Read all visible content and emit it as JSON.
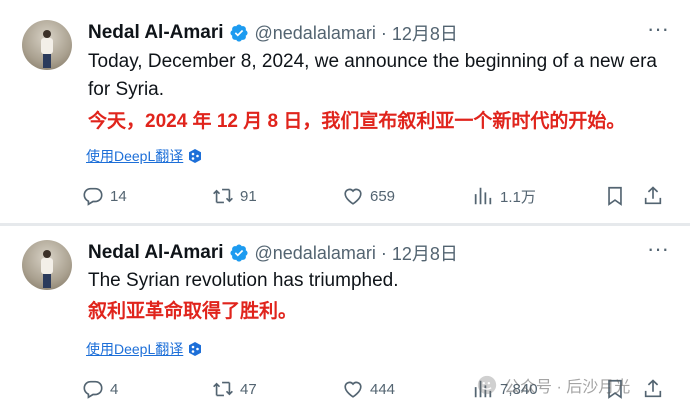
{
  "tweets": [
    {
      "author_name": "Nedal Al-Amari",
      "handle": "@nedalalamari",
      "separator": "·",
      "date": "12月8日",
      "text_en": "Today, December 8, 2024, we announce the beginning of a new era for Syria.",
      "text_zh": "今天，2024 年 12 月 8 日，我们宣布叙利亚一个新时代的开始。",
      "translate_label": "使用DeepL翻译",
      "replies": "14",
      "retweets": "91",
      "likes": "659",
      "views": "1.1万"
    },
    {
      "author_name": "Nedal Al-Amari",
      "handle": "@nedalalamari",
      "separator": "·",
      "date": "12月8日",
      "text_en": "The Syrian revolution has triumphed.",
      "text_zh": "叙利亚革命取得了胜利。",
      "translate_label": "使用DeepL翻译",
      "replies": "4",
      "retweets": "47",
      "likes": "444",
      "views": "7,840"
    }
  ],
  "watermark": "公众号 · 后沙月光",
  "colors": {
    "verified": "#1d9bf0",
    "chinese_text": "#e0241c",
    "link": "#1d6fd8",
    "secondary": "#536471"
  }
}
